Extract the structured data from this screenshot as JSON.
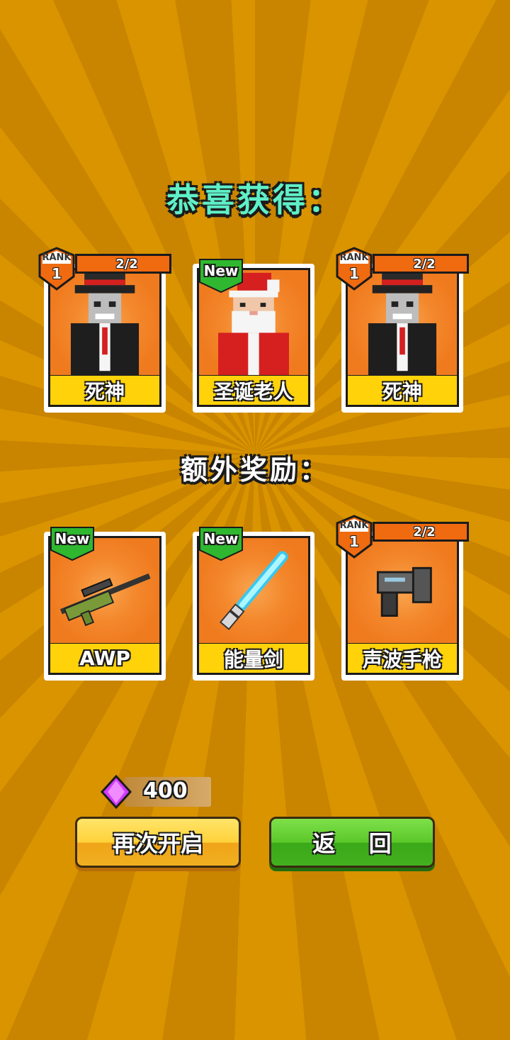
{
  "header": {
    "title": "恭喜获得：",
    "bonus_title": "额外奖励："
  },
  "rewards": [
    {
      "name": "死神",
      "rank_label": "RANK",
      "rank": "1",
      "progress": "2/2",
      "character": "reaper"
    },
    {
      "name": "圣诞老人",
      "badge": "New",
      "character": "santa"
    },
    {
      "name": "死神",
      "rank_label": "RANK",
      "rank": "1",
      "progress": "2/2",
      "character": "reaper"
    }
  ],
  "bonus": [
    {
      "name": "AWP",
      "badge": "New",
      "item": "sniper-rifle"
    },
    {
      "name": "能量剑",
      "badge": "New",
      "item": "energy-sword"
    },
    {
      "name": "声波手枪",
      "rank_label": "RANK",
      "rank": "1",
      "progress": "2/2",
      "item": "sonic-pistol"
    }
  ],
  "currency": {
    "icon": "gem-icon",
    "amount": "400",
    "color": "#d23cff"
  },
  "actions": {
    "reopen_label": "再次开启",
    "back_label": "返 回"
  }
}
